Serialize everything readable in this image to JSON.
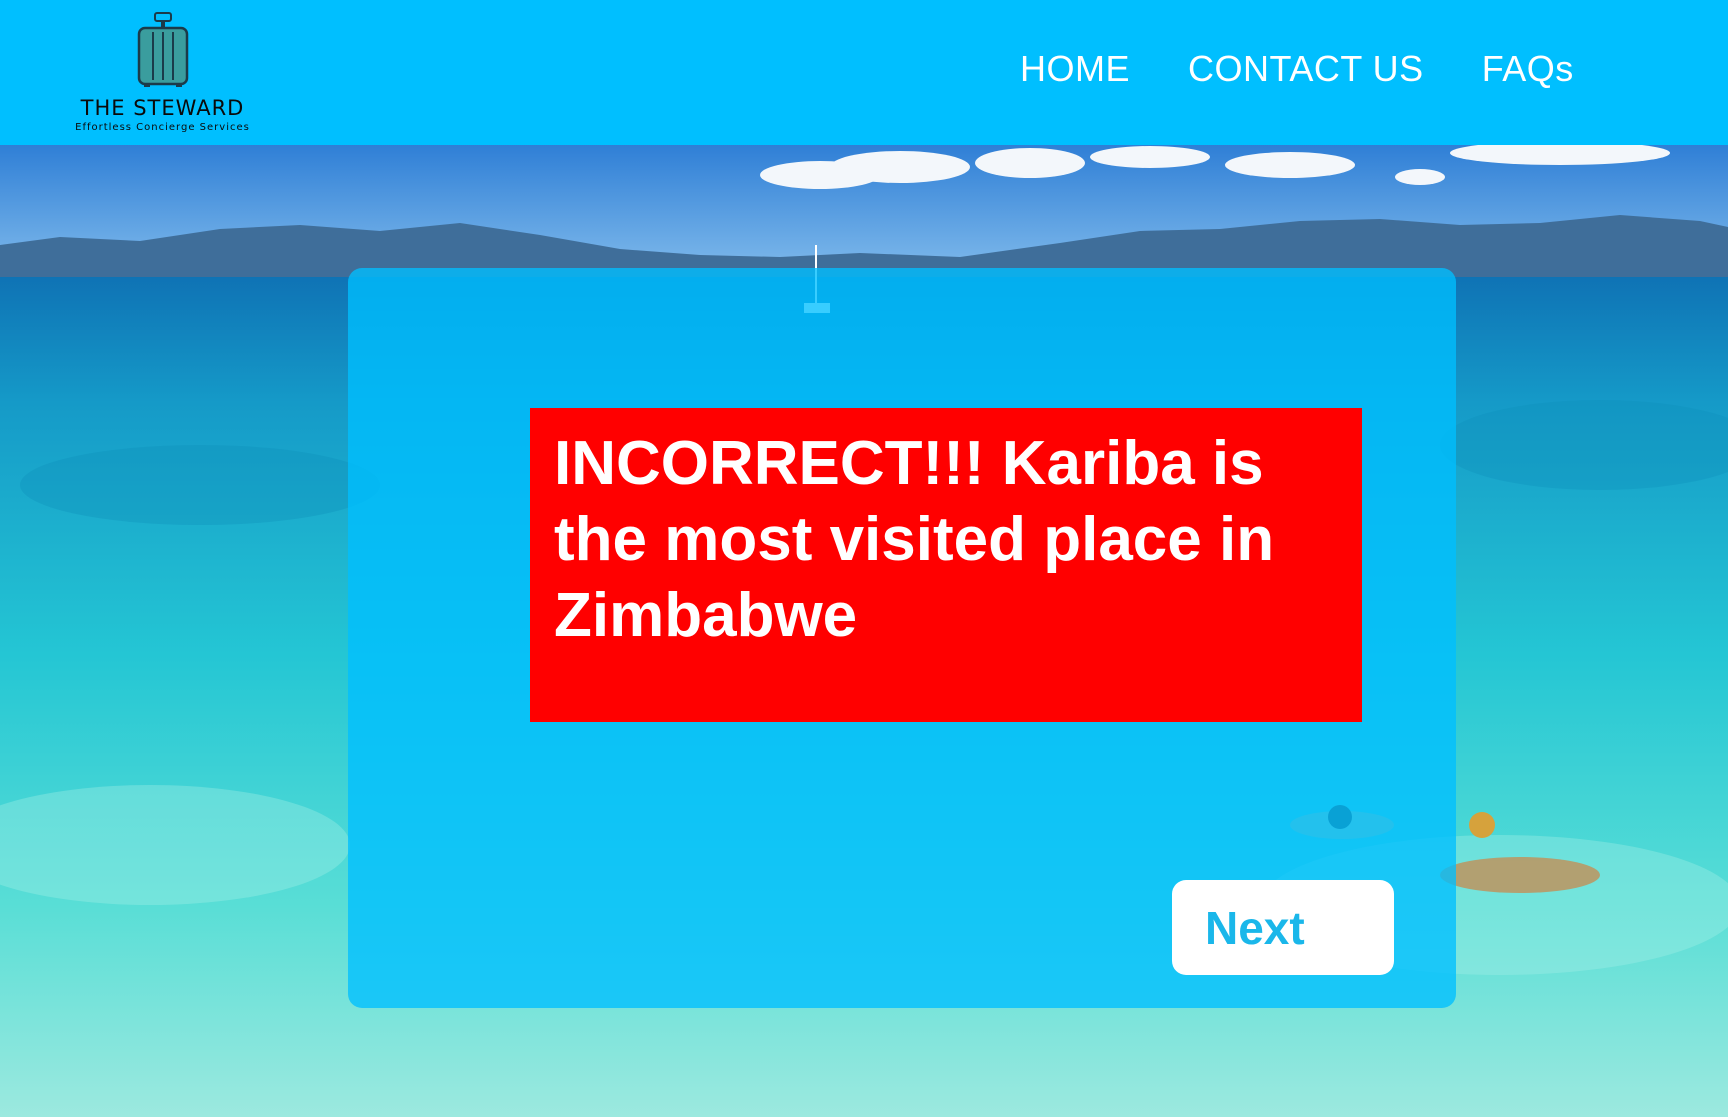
{
  "header": {
    "brand": {
      "title": "THE STEWARD",
      "tagline": "Effortless Concierge Services",
      "icon": "suitcase-icon"
    },
    "nav": [
      {
        "label": "HOME"
      },
      {
        "label": "CONTACT US"
      },
      {
        "label": "FAQs"
      }
    ]
  },
  "quiz": {
    "result_message": "INCORRECT!!! Kariba is the most visited place in Zimbabwe",
    "next_label": "Next"
  },
  "colors": {
    "header_bg": "#00bfff",
    "panel_bg": "#00bfff",
    "result_bg": "#ff0000",
    "button_bg": "#ffffff",
    "button_text": "#1ab7ea"
  }
}
